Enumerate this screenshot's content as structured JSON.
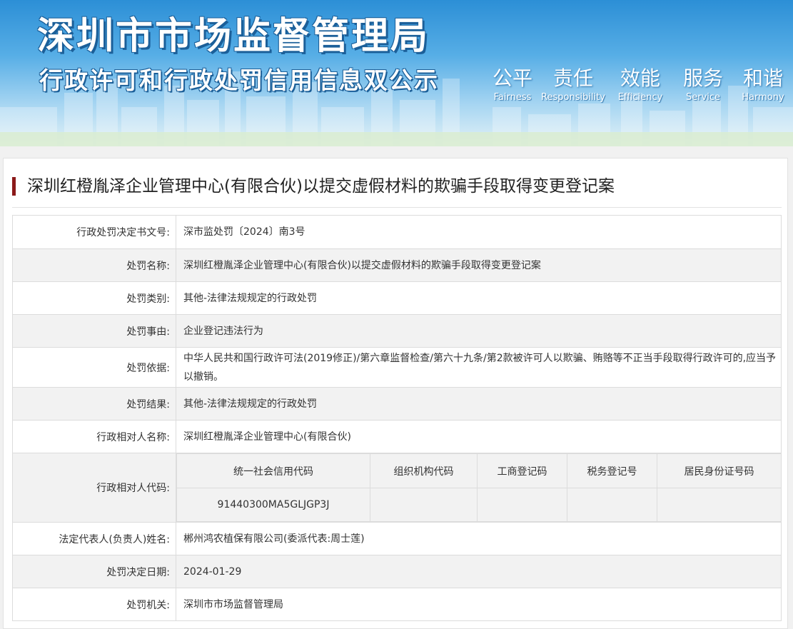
{
  "header": {
    "title": "深圳市市场监督管理局",
    "subtitle": "行政许可和行政处罚信用信息双公示",
    "slogans": [
      {
        "cn": "公平",
        "en": "Fairness"
      },
      {
        "cn": "责任",
        "en": "Responsibility"
      },
      {
        "cn": "效能",
        "en": "Efficiency"
      },
      {
        "cn": "服务",
        "en": "Service"
      },
      {
        "cn": "和谐",
        "en": "Harmony"
      }
    ]
  },
  "page_title": "深圳红橙胤泽企业管理中心(有限合伙)以提交虚假材料的欺骗手段取得变更登记案",
  "fields": {
    "doc_no": {
      "label": "行政处罚决定书文号:",
      "value": "深市监处罚〔2024〕南3号"
    },
    "name": {
      "label": "处罚名称:",
      "value": "深圳红橙胤泽企业管理中心(有限合伙)以提交虚假材料的欺骗手段取得变更登记案"
    },
    "category": {
      "label": "处罚类别:",
      "value": "其他-法律法规规定的行政处罚"
    },
    "reason": {
      "label": "处罚事由:",
      "value": "企业登记违法行为"
    },
    "basis": {
      "label": "处罚依据:",
      "value": "中华人民共和国行政许可法(2019修正)/第六章监督检查/第六十九条/第2款被许可人以欺骗、贿赂等不正当手段取得行政许可的,应当予以撤销。"
    },
    "result": {
      "label": "处罚结果:",
      "value": "其他-法律法规规定的行政处罚"
    },
    "party_name": {
      "label": "行政相对人名称:",
      "value": "深圳红橙胤泽企业管理中心(有限合伙)"
    },
    "party_code": {
      "label": "行政相对人代码:",
      "headers": [
        "统一社会信用代码",
        "组织机构代码",
        "工商登记码",
        "税务登记号",
        "居民身份证号码"
      ],
      "values": [
        "91440300MA5GLJGP3J",
        "",
        "",
        "",
        ""
      ]
    },
    "legal_rep": {
      "label": "法定代表人(负责人)姓名:",
      "value": "郴州鸿农植保有限公司(委派代表:周士莲)"
    },
    "date": {
      "label": "处罚决定日期:",
      "value": "2024-01-29"
    },
    "authority": {
      "label": "处罚机关:",
      "value": "深圳市市场监督管理局"
    }
  },
  "colors": {
    "title_accent": "#8b1a1a",
    "row_alt": "#f2f2f2",
    "banner_top": "#2c8fd6"
  }
}
